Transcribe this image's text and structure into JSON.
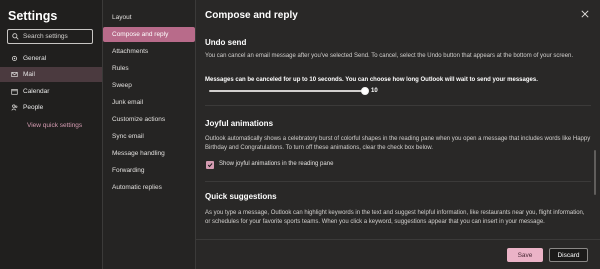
{
  "settings": {
    "title": "Settings",
    "search_placeholder": "Search settings",
    "categories": [
      {
        "label": "General",
        "icon": "gear-icon"
      },
      {
        "label": "Mail",
        "icon": "mail-icon",
        "active": true
      },
      {
        "label": "Calendar",
        "icon": "calendar-icon"
      },
      {
        "label": "People",
        "icon": "people-icon"
      }
    ],
    "view_quick_settings": "View quick settings"
  },
  "submenu": {
    "items": [
      {
        "label": "Layout"
      },
      {
        "label": "Compose and reply",
        "active": true
      },
      {
        "label": "Attachments"
      },
      {
        "label": "Rules"
      },
      {
        "label": "Sweep"
      },
      {
        "label": "Junk email"
      },
      {
        "label": "Customize actions"
      },
      {
        "label": "Sync email"
      },
      {
        "label": "Message handling"
      },
      {
        "label": "Forwarding"
      },
      {
        "label": "Automatic replies"
      }
    ]
  },
  "main": {
    "title": "Compose and reply",
    "undo_send": {
      "title": "Undo send",
      "description": "You can cancel an email message after you've selected Send. To cancel, select the Undo button that appears at the bottom of your screen.",
      "slider_caption": "Messages can be canceled for up to 10 seconds. You can choose how long Outlook will wait to send your messages.",
      "slider_value": "10",
      "slider_fraction": 1.0
    },
    "joyful": {
      "title": "Joyful animations",
      "description": "Outlook automatically shows a celebratory burst of colorful shapes in the reading pane when you open a message that includes words like Happy Birthday and Congratulations. To turn off these animations, clear the check box below.",
      "checkbox_label": "Show joyful animations in the reading pane",
      "checked": true
    },
    "quick_suggestions": {
      "title": "Quick suggestions",
      "description": "As you type a message, Outlook can highlight keywords in the text and suggest helpful information, like restaurants near you, flight information, or schedules for your favorite sports teams. When you click a keyword, suggestions appear that you can insert in your message."
    }
  },
  "footer": {
    "save_label": "Save",
    "discard_label": "Discard"
  },
  "colors": {
    "accent": "#b86b8a",
    "save_bg": "#ebb3c7",
    "background": "#1b1a19"
  }
}
